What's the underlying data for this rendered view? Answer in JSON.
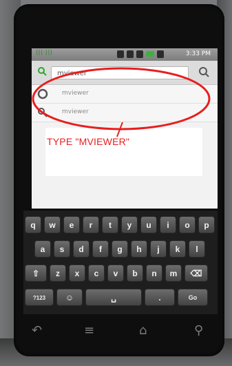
{
  "status_bar": {
    "carrier_icon": "android-notification-icon",
    "carrier_text": "(((·)))",
    "time": "3:33 PM"
  },
  "search": {
    "query": "mviewer",
    "left_icon": "search-icon",
    "right_icon": "search-icon"
  },
  "suggestions": [
    {
      "icon": "history-icon",
      "text": "mviewer"
    },
    {
      "icon": "search-icon",
      "text": "mviewer"
    }
  ],
  "annotation": {
    "text": "TYPE \"MVIEWER\"",
    "color": "#e81e1e"
  },
  "keyboard": {
    "rows": [
      [
        "q",
        "w",
        "e",
        "r",
        "t",
        "y",
        "u",
        "i",
        "o",
        "p"
      ],
      [
        "a",
        "s",
        "d",
        "f",
        "g",
        "h",
        "j",
        "k",
        "l"
      ],
      [
        "⇧",
        "z",
        "x",
        "c",
        "v",
        "b",
        "n",
        "m",
        "⌫"
      ],
      [
        "?123",
        "☺",
        "␣",
        ".",
        "Go"
      ]
    ]
  },
  "softkeys": [
    "back-icon",
    "menu-icon",
    "home-icon",
    "search-icon"
  ]
}
